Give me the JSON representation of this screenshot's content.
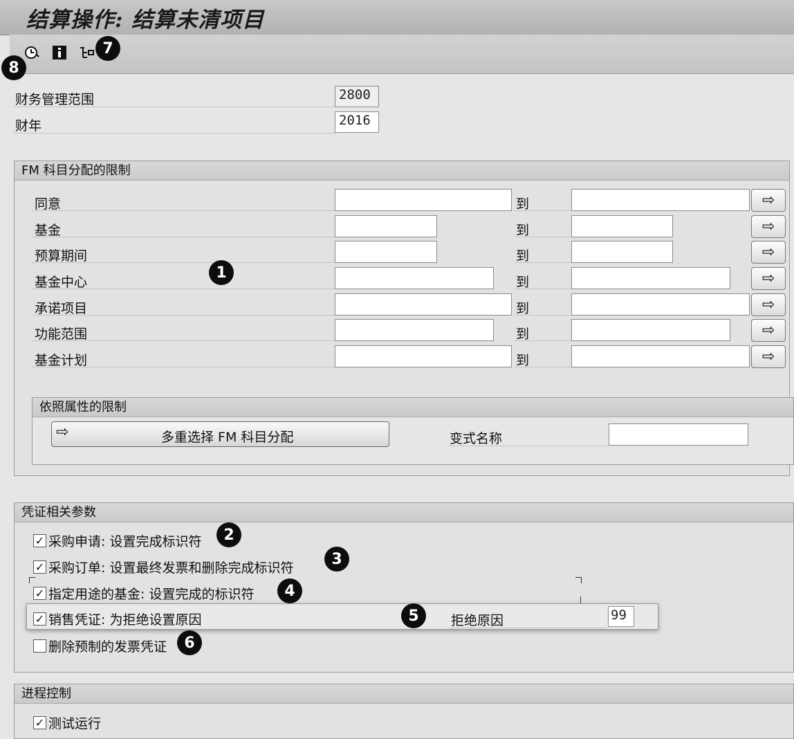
{
  "window": {
    "title": "结算操作: 结算未清项目"
  },
  "toolbar": {
    "icons": [
      "execute-clock-icon",
      "info-icon",
      "program-tree-icon"
    ]
  },
  "callouts": {
    "c1": "1",
    "c2": "2",
    "c3": "3",
    "c4": "4",
    "c5": "5",
    "c6": "6",
    "c7": "7",
    "c8": "8"
  },
  "header_fields": {
    "fm_area": {
      "label": "财务管理范围",
      "value": "2800"
    },
    "fiscal_year": {
      "label": "财年",
      "value": "2016"
    }
  },
  "fm_restrictions": {
    "title": "FM 科目分配的限制",
    "to_label": "到",
    "rows": [
      {
        "label": "同意"
      },
      {
        "label": "基金"
      },
      {
        "label": "预算期间"
      },
      {
        "label": "基金中心"
      },
      {
        "label": "承诺项目"
      },
      {
        "label": "功能范围"
      },
      {
        "label": "基金计划"
      }
    ],
    "attribute_group": {
      "title": "依照属性的限制",
      "multi_select_button": "多重选择 FM 科目分配",
      "variant_label": "变式名称",
      "variant_value": ""
    }
  },
  "doc_params": {
    "title": "凭证相关参数",
    "items": [
      {
        "label": "采购申请: 设置完成标识符",
        "checked": true
      },
      {
        "label": "采购订单: 设置最终发票和删除完成标识符",
        "checked": true
      },
      {
        "label": "指定用途的基金: 设置完成的标识符",
        "checked": true
      },
      {
        "label": "销售凭证: 为拒绝设置原因",
        "checked": true
      },
      {
        "label": "删除预制的发票凭证",
        "checked": false
      }
    ],
    "reject_reason": {
      "label": "拒绝原因",
      "value": "99"
    }
  },
  "process_control": {
    "title": "进程控制",
    "test_run": {
      "label": "测试运行",
      "checked": true
    }
  },
  "glyphs": {
    "check": "✓",
    "arrow": "⇨"
  }
}
